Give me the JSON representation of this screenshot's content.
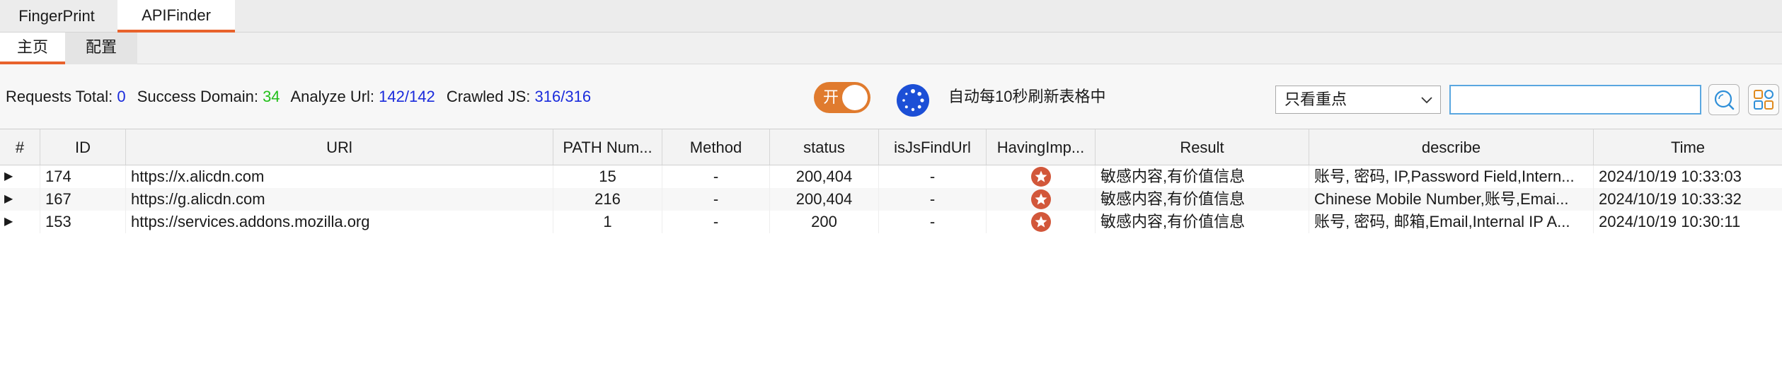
{
  "tabs": [
    {
      "label": "FingerPrint",
      "active": false
    },
    {
      "label": "APIFinder",
      "active": true
    }
  ],
  "subtabs": [
    {
      "label": "主页",
      "active": true
    },
    {
      "label": "配置",
      "active": false
    }
  ],
  "stats": {
    "requests_label": "Requests Total:",
    "requests_value": "0",
    "success_label": "Success Domain:",
    "success_value": "34",
    "analyze_label": "Analyze Url:",
    "analyze_value": "142/142",
    "crawled_label": "Crawled JS:",
    "crawled_value": "316/316"
  },
  "toggle": {
    "label": "开",
    "state": "on",
    "color": "#e07b2e"
  },
  "refresh": {
    "icon": "loading-spinner-icon",
    "text": "自动每10秒刷新表格中"
  },
  "filter": {
    "selected": "只看重点"
  },
  "search": {
    "value": "",
    "placeholder": ""
  },
  "buttons": {
    "search_icon": "search-icon",
    "settings_icon": "grid-settings-icon"
  },
  "table": {
    "columns": [
      "#",
      "ID",
      "URl",
      "PATH Num...",
      "Method",
      "status",
      "isJsFindUrl",
      "HavingImp...",
      "Result",
      "describe",
      "Time"
    ],
    "rows": [
      {
        "expander": "▶",
        "id": "174",
        "url": "https://x.alicdn.com",
        "path_num": "15",
        "method": "-",
        "status": "200,404",
        "is_js_find_url": "-",
        "having_important": "star",
        "result": "敏感内容,有价值信息",
        "describe": "账号, 密码, IP,Password Field,Intern...",
        "time": "2024/10/19 10:33:03"
      },
      {
        "expander": "▶",
        "id": "167",
        "url": "https://g.alicdn.com",
        "path_num": "216",
        "method": "-",
        "status": "200,404",
        "is_js_find_url": "-",
        "having_important": "star",
        "result": "敏感内容,有价值信息",
        "describe": "Chinese Mobile Number,账号,Emai...",
        "time": "2024/10/19 10:33:32"
      },
      {
        "expander": "▶",
        "id": "153",
        "url": "https://services.addons.mozilla.org",
        "path_num": "1",
        "method": "-",
        "status": "200",
        "is_js_find_url": "-",
        "having_important": "star",
        "result": "敏感内容,有价值信息",
        "describe": "账号, 密码, 邮箱,Email,Internal IP A...",
        "time": "2024/10/19 10:30:11"
      }
    ]
  },
  "colors": {
    "accent": "#e8622c",
    "value_blue": "#1a2bdc",
    "value_green": "#22c01a",
    "star_badge": "#d2573a"
  }
}
